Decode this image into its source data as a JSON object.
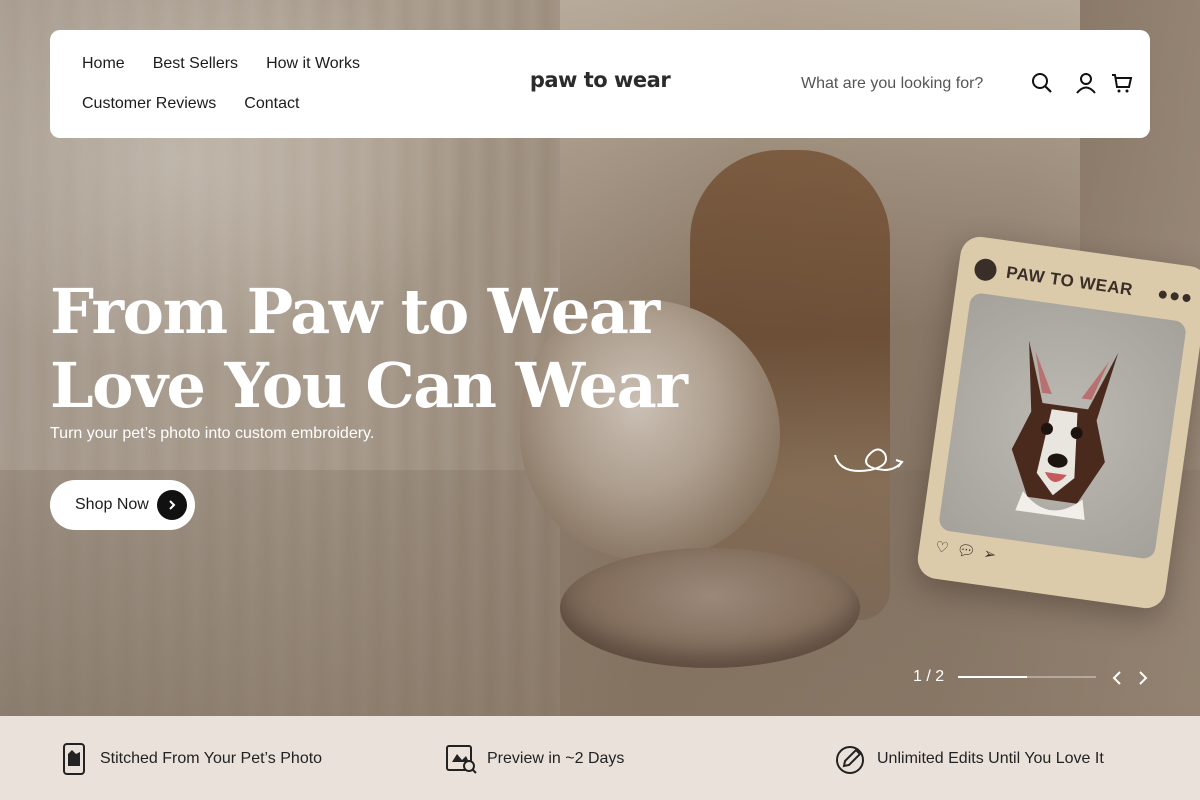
{
  "header": {
    "nav": [
      {
        "label": "Home"
      },
      {
        "label": "Best Sellers"
      },
      {
        "label": "How it Works"
      },
      {
        "label": "Customer Reviews"
      },
      {
        "label": "Contact"
      }
    ],
    "logo": "paw to wear",
    "search_placeholder": "What are you looking for?",
    "icons": [
      "search-icon",
      "account-icon",
      "cart-icon"
    ]
  },
  "hero": {
    "headline_line1": "From Paw to Wear",
    "headline_line2": "Love You Can Wear",
    "subheadline": "Turn your pet’s photo into custom embroidery.",
    "cta_label": "Shop Now",
    "card_title": "PAW TO WEAR",
    "slide_counter": "1 / 2",
    "slide_progress": 0.5
  },
  "features": [
    {
      "icon": "phone-photo-icon",
      "label": "Stitched From Your Pet’s Photo"
    },
    {
      "icon": "preview-icon",
      "label": "Preview in ~2 Days"
    },
    {
      "icon": "edit-icon",
      "label": "Unlimited Edits Until You Love It"
    }
  ],
  "colors": {
    "header_bg": "#ffffff",
    "text_dark": "#1c1c1c",
    "feature_bar_bg": "#eae2da",
    "card_bg": "#dccbaa"
  }
}
